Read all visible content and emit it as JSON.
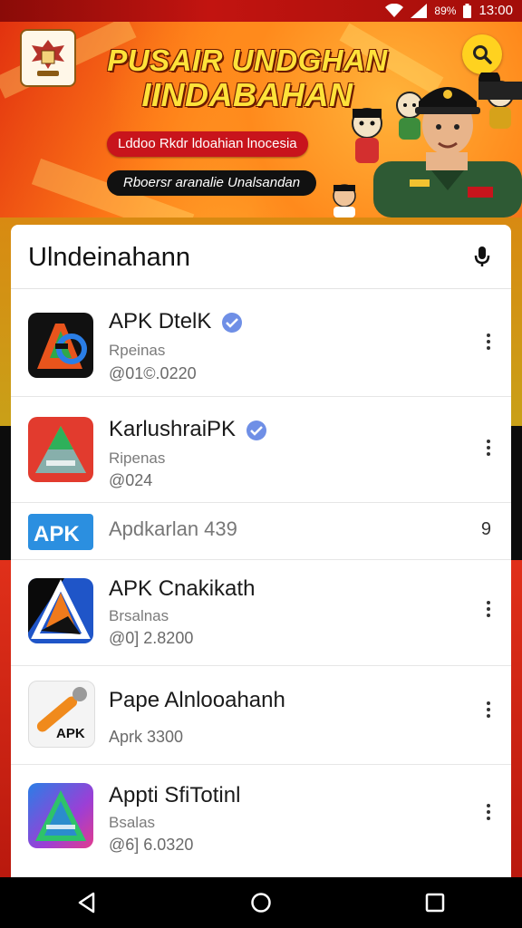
{
  "status_bar": {
    "battery_percent": "89%",
    "time": "13:00",
    "icons": [
      "wifi-icon",
      "signal-icon",
      "battery-icon"
    ]
  },
  "banner": {
    "title_line1": "PUSAIR UNDGHAN",
    "title_line2": "IINDABAHAN",
    "subtitle": "Lddoo Rkdr ldoahian lnocesia",
    "tagline": "Rboersr aranalie Unalsandan",
    "search_icon": "search-icon",
    "colors": {
      "primary": "#c41a10",
      "accent": "#ffd21f",
      "title": "#ffe23a"
    }
  },
  "panel": {
    "title": "Ulndeinahann",
    "mic_icon": "mic-icon"
  },
  "apps": [
    {
      "name": "APK DtelK",
      "verified": true,
      "category": "Rpeinas",
      "meta": "@01©.0220",
      "icon": "apk-logo-icon"
    },
    {
      "name": "KarlushraiPK",
      "verified": true,
      "category": "Ripenas",
      "meta": "@024",
      "icon": "triangle-logo-icon"
    },
    {
      "name": "Apdkarlan 439",
      "verified": false,
      "category": "",
      "meta": "",
      "icon": "apk-blue-icon",
      "more_label": "9"
    },
    {
      "name": "APK Cnakikath",
      "verified": false,
      "category": "Brsalnas",
      "meta": "@0] 2.8200",
      "icon": "apk-dark-icon"
    },
    {
      "name": "Pape Alnlooahanh",
      "verified": false,
      "category": "",
      "meta": "Aprk 3300",
      "icon": "wrench-apk-icon"
    },
    {
      "name": "Appti SfiTotinl",
      "verified": false,
      "category": "Bsalas",
      "meta": "@6] 6.0320",
      "icon": "gradient-a-icon"
    }
  ],
  "nav_bar": {
    "icons": [
      "back-icon",
      "home-icon",
      "recents-icon"
    ]
  }
}
